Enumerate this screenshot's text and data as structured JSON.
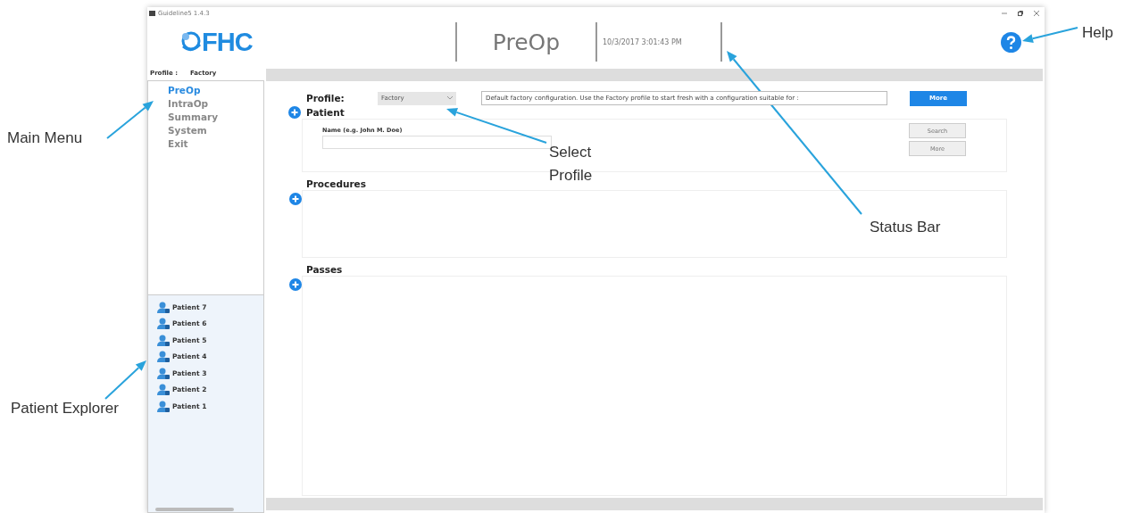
{
  "window": {
    "title": "Guideline5 1.4.3"
  },
  "header": {
    "logo": "FHC",
    "page_title": "PreOp",
    "status_bar": "10/3/2017 3:01:43 PM"
  },
  "profile_indicator": {
    "label": "Profile :",
    "value": "Factory"
  },
  "main_menu": [
    {
      "label": "PreOp",
      "selected": true
    },
    {
      "label": "IntraOp",
      "selected": false
    },
    {
      "label": "Summary",
      "selected": false
    },
    {
      "label": "System",
      "selected": false
    },
    {
      "label": "Exit",
      "selected": false
    }
  ],
  "patient_explorer": [
    {
      "label": "Patient 7"
    },
    {
      "label": "Patient 6"
    },
    {
      "label": "Patient 5"
    },
    {
      "label": "Patient 4"
    },
    {
      "label": "Patient 3"
    },
    {
      "label": "Patient 2"
    },
    {
      "label": "Patient 1"
    }
  ],
  "profile": {
    "label": "Profile:",
    "selected": "Factory",
    "description": "Default factory configuration. Use the Factory profile to start fresh with a configuration suitable for :",
    "button": "More"
  },
  "sections": [
    {
      "title": "Patient",
      "kind": "patient",
      "field_label": "Name (e.g. John M. Doe)",
      "buttons": [
        "Search",
        "More"
      ]
    },
    {
      "title": "Procedures",
      "kind": "empty"
    },
    {
      "title": "Passes",
      "kind": "empty"
    }
  ],
  "annotations": [
    {
      "text": "Main Menu"
    },
    {
      "text": "Patient Explorer"
    },
    {
      "text": "Select Profile"
    },
    {
      "text": "Status Bar"
    },
    {
      "text": "Help"
    }
  ]
}
